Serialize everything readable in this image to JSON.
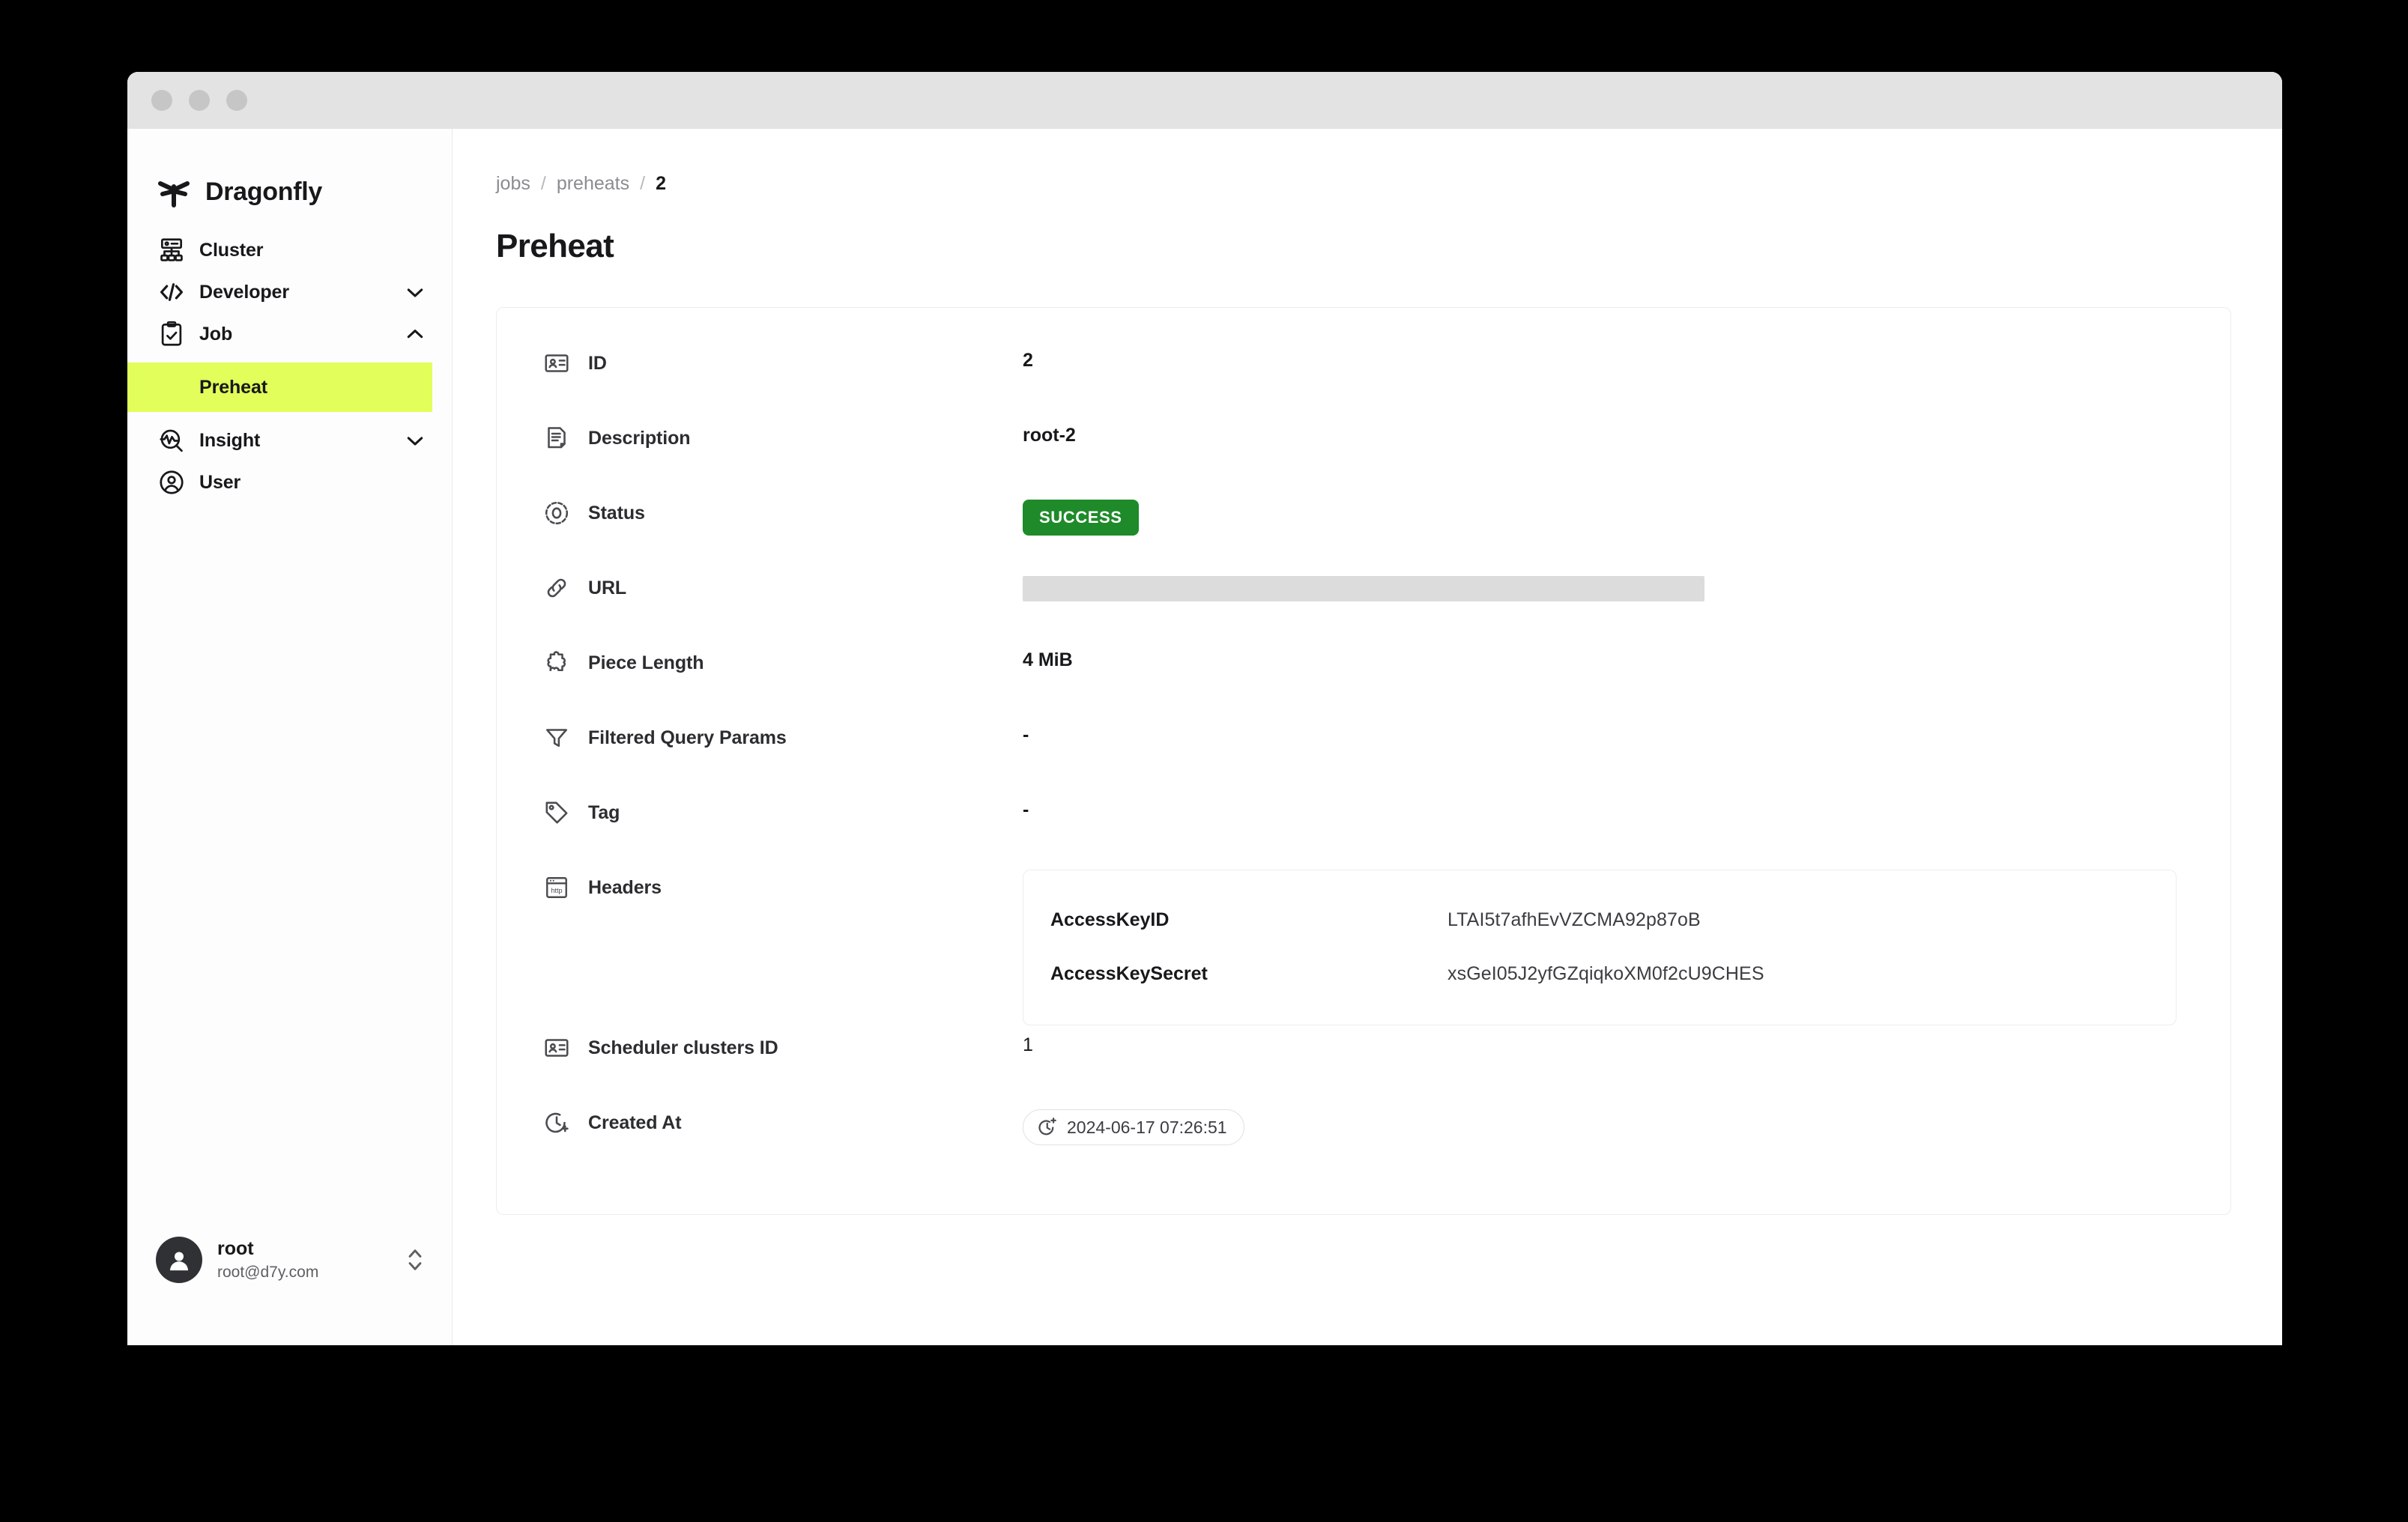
{
  "window": {
    "traffic_lights": [
      "close",
      "minimize",
      "maximize"
    ]
  },
  "sidebar": {
    "brand": {
      "name": "Dragonfly",
      "logo_icon": "dragonfly-logo-icon"
    },
    "items": [
      {
        "label": "Cluster",
        "icon": "cluster-icon",
        "expandable": false,
        "expanded": null
      },
      {
        "label": "Developer",
        "icon": "code-icon",
        "expandable": true,
        "expanded": false
      },
      {
        "label": "Job",
        "icon": "clipboard-check-icon",
        "expandable": true,
        "expanded": true
      },
      {
        "label": "Insight",
        "icon": "insight-chart-search-icon",
        "expandable": true,
        "expanded": false
      },
      {
        "label": "User",
        "icon": "user-circle-icon",
        "expandable": false,
        "expanded": null
      }
    ],
    "job_children": [
      {
        "label": "Preheat",
        "active": true
      }
    ],
    "profile": {
      "name": "root",
      "email": "root@d7y.com",
      "avatar_icon": "avatar-person-icon",
      "switch_icon": "chevron-up-down-icon"
    }
  },
  "main": {
    "breadcrumb": {
      "items": [
        {
          "label": "jobs",
          "current": false
        },
        {
          "label": "preheats",
          "current": false
        },
        {
          "label": "2",
          "current": true
        }
      ],
      "separator": "/"
    },
    "page_title": "Preheat",
    "details": [
      {
        "label": "ID",
        "icon": "id-card-icon",
        "value": "2",
        "kind": "strong"
      },
      {
        "label": "Description",
        "icon": "document-icon",
        "value": "root-2",
        "kind": "strong"
      },
      {
        "label": "Status",
        "icon": "status-circle-icon",
        "value": "SUCCESS",
        "kind": "badge"
      },
      {
        "label": "URL",
        "icon": "link-icon",
        "value": "",
        "kind": "redacted"
      },
      {
        "label": "Piece Length",
        "icon": "puzzle-piece-icon",
        "value": "4 MiB",
        "kind": "strong"
      },
      {
        "label": "Filtered Query Params",
        "icon": "funnel-icon",
        "value": "-",
        "kind": "dash"
      },
      {
        "label": "Tag",
        "icon": "tag-icon",
        "value": "-",
        "kind": "dash"
      },
      {
        "label": "Headers",
        "icon": "http-window-icon",
        "value": "",
        "kind": "headers"
      },
      {
        "label": "Scheduler clusters ID",
        "icon": "id-card-icon",
        "value": "1",
        "kind": "plain"
      },
      {
        "label": "Created At",
        "icon": "clock-plus-icon",
        "value": "2024-06-17 07:26:51",
        "kind": "chip"
      }
    ],
    "headers_table": {
      "rows": [
        {
          "key": "AccessKeyID",
          "value": "LTAI5t7afhEvVZCMA92p87oB"
        },
        {
          "key": "AccessKeySecret",
          "value": "xsGeI05J2yfGZqiqkoXM0f2cU9CHES"
        }
      ]
    },
    "status_badge_color": "#1F8A2A",
    "active_nav_color": "#E2FE5A"
  }
}
